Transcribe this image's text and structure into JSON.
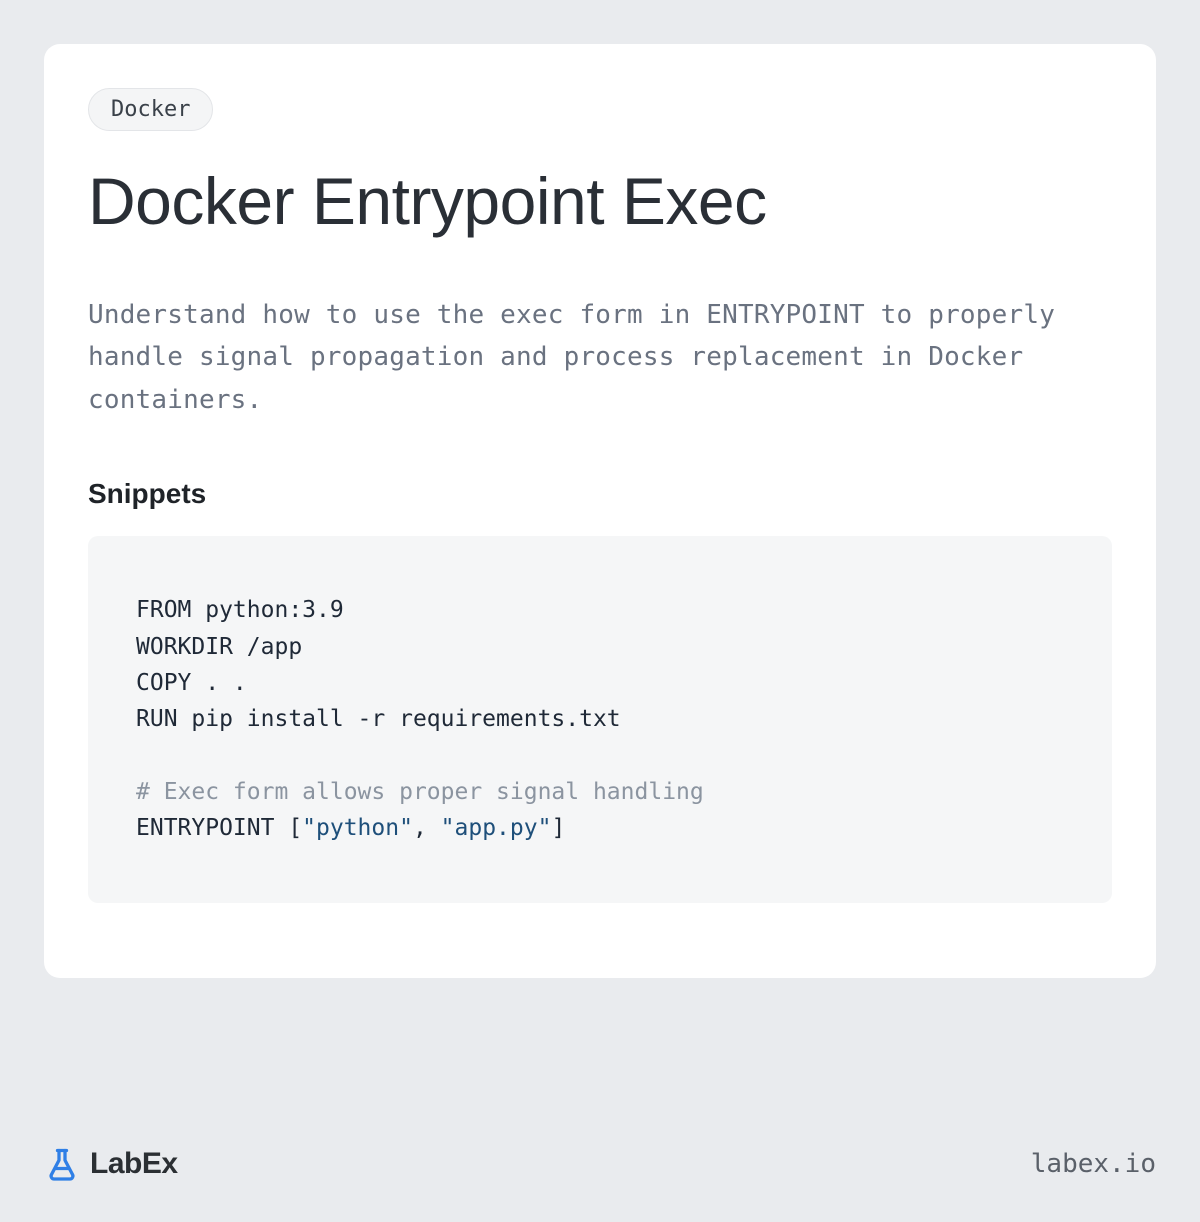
{
  "tag": "Docker",
  "title": "Docker Entrypoint Exec",
  "description": "Understand how to use the exec form in ENTRYPOINT to properly handle signal propagation and process replacement in Docker containers.",
  "snippets_heading": "Snippets",
  "code": {
    "l1": "FROM python:3.9",
    "l2": "WORKDIR /app",
    "l3": "COPY . .",
    "l4": "RUN pip install -r requirements.txt",
    "l5_comment": "# Exec form allows proper signal handling",
    "l6_a": "ENTRYPOINT [",
    "l6_s1": "\"python\"",
    "l6_b": ", ",
    "l6_s2": "\"app.py\"",
    "l6_c": "]"
  },
  "brand": "LabEx",
  "site": "labex.io"
}
